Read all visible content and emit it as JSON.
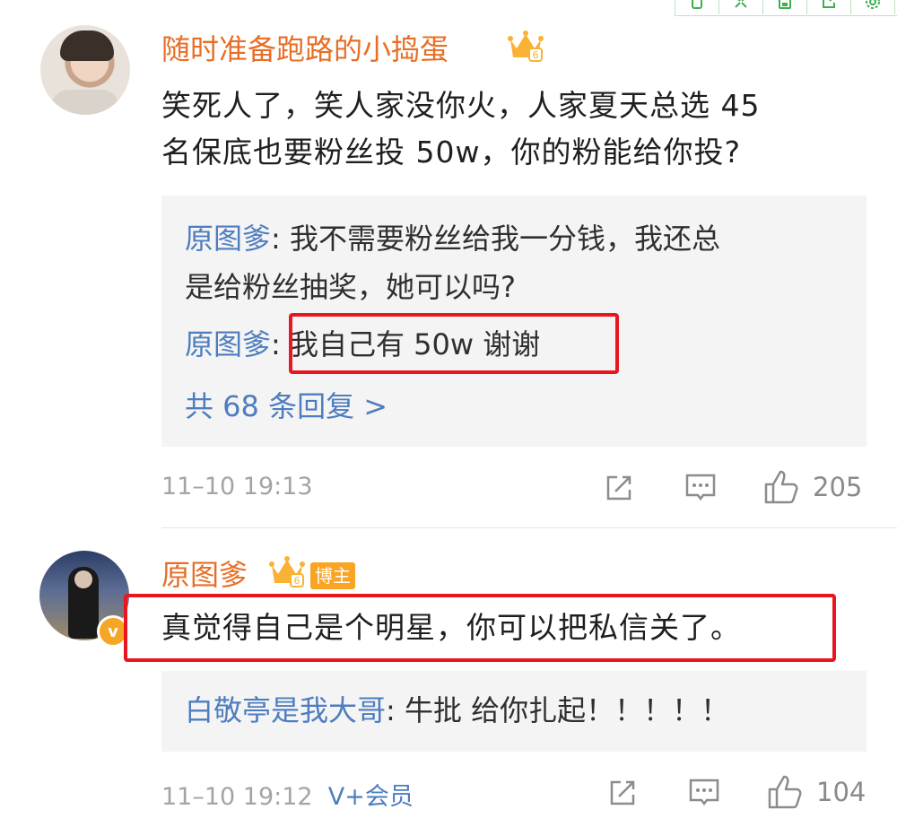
{
  "toolbar": {
    "icons": [
      "copy-icon",
      "expand-icon",
      "save-icon",
      "external-link-icon",
      "settings-icon"
    ]
  },
  "comments": [
    {
      "username": "随时准备跑路的小捣蛋",
      "text_line1": "笑死人了，笑人家没你火，人家夏天总选 45",
      "text_line2": "名保底也要粉丝投 50w，你的粉能给你投?",
      "replies": [
        {
          "author": "原图爹",
          "text_line1": ": 我不需要粉丝给我一分钱，我还总",
          "text_line2": "是给粉丝抽奖，她可以吗?"
        },
        {
          "author": "原图爹",
          "text": ": 我自己有 50w 谢谢"
        }
      ],
      "more_replies": "共 68 条回复 >",
      "time": "11–10 19:13",
      "likes": "205"
    },
    {
      "username": "原图爹",
      "badge": "博主",
      "avatar_badge": "v",
      "text": "真觉得自己是个明星，你可以把私信关了。",
      "replies": [
        {
          "author": "白敬亭是我大哥",
          "text": ": 牛批 给你扎起！！！！！"
        }
      ],
      "time": "11–10 19:12",
      "vip": "V+会员",
      "likes": "104"
    }
  ],
  "colors": {
    "username": "#e86e25",
    "link": "#4e7dbf",
    "highlight": "#e8171f",
    "badge": "#f9a423"
  }
}
